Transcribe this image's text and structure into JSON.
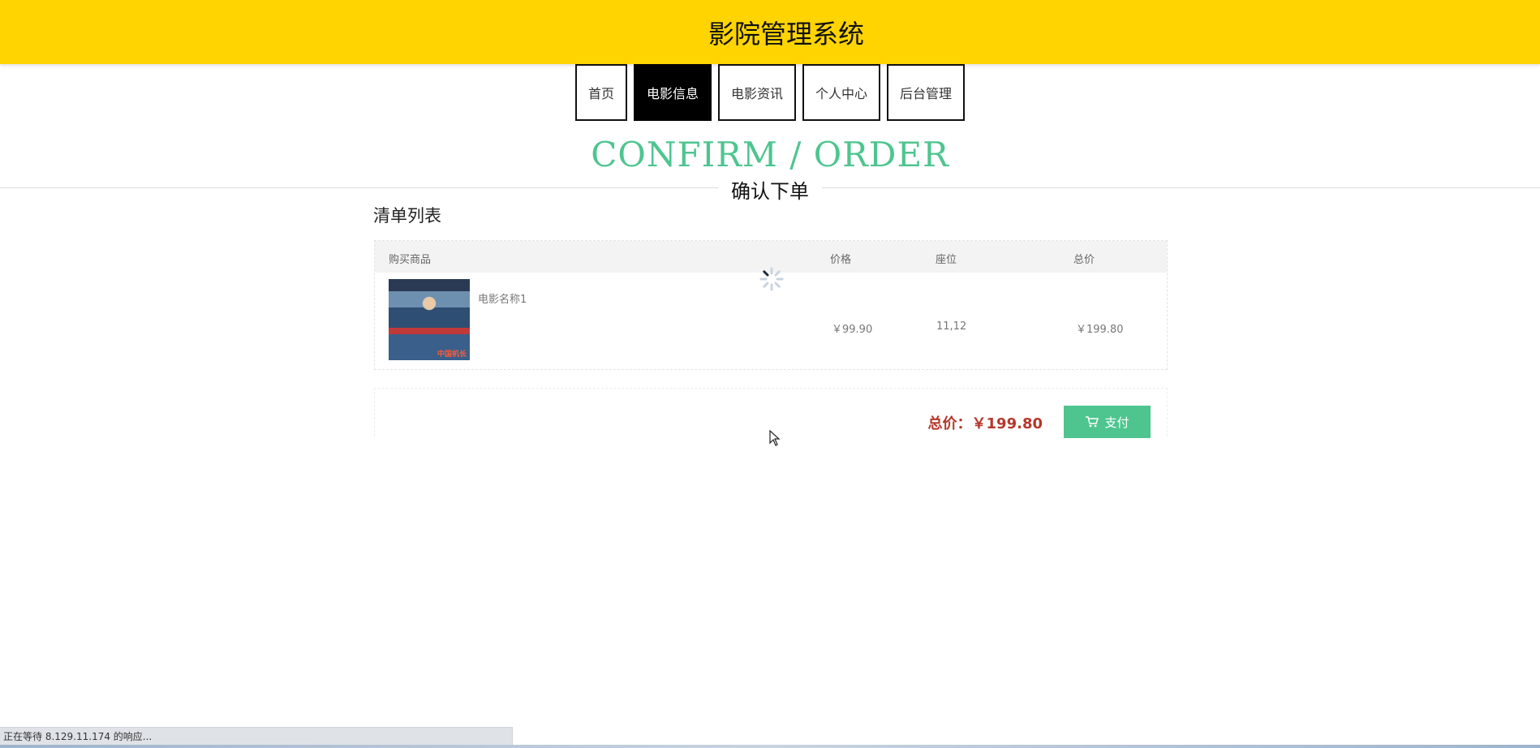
{
  "header": {
    "title": "影院管理系统",
    "bg_color": "#FFD400"
  },
  "nav": {
    "items": [
      {
        "label": "首页",
        "active": false
      },
      {
        "label": "电影信息",
        "active": true
      },
      {
        "label": "电影资讯",
        "active": false
      },
      {
        "label": "个人中心",
        "active": false
      },
      {
        "label": "后台管理",
        "active": false
      }
    ]
  },
  "page": {
    "heading_en": "CONFIRM / ORDER",
    "heading_cn": "确认下单",
    "accent_color": "#4ec58f"
  },
  "order": {
    "section_title": "清单列表",
    "columns": {
      "product": "购买商品",
      "price": "价格",
      "seat": "座位",
      "total": "总价"
    },
    "items": [
      {
        "name": "电影名称1",
        "price": "￥99.90",
        "seat": "11,12",
        "total": "￥199.80",
        "poster_caption": "中国机长"
      }
    ]
  },
  "payment": {
    "total_label": "总价：",
    "total_value": "￥199.80",
    "pay_label": "支付"
  },
  "status": {
    "text": "正在等待 8.129.11.174 的响应..."
  },
  "icons": {
    "spinner": "loading-spinner-icon",
    "cart": "cart-icon",
    "cursor": "mouse-pointer-icon"
  }
}
